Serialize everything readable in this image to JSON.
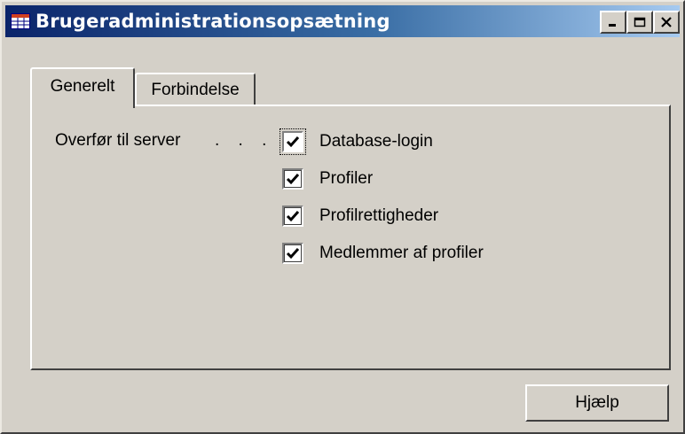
{
  "window": {
    "title": "Brugeradministrationsopsætning",
    "icon": "table-icon",
    "controls": {
      "minimize_icon": "minimize-icon",
      "maximize_icon": "maximize-icon",
      "close_icon": "close-icon"
    },
    "colors": {
      "titlebar_start": "#0a246a",
      "titlebar_end": "#a6caf0",
      "face": "#d4d0c8"
    }
  },
  "tabs": [
    {
      "label": "Generelt",
      "active": true
    },
    {
      "label": "Forbindelse",
      "active": false
    }
  ],
  "form": {
    "field_label": "Overfør til server",
    "leader_dots": ". . . .",
    "options": [
      {
        "label": "Database-login",
        "checked": true
      },
      {
        "label": "Profiler",
        "checked": true
      },
      {
        "label": "Profilrettigheder",
        "checked": true
      },
      {
        "label": "Medlemmer af profiler",
        "checked": true
      }
    ]
  },
  "buttons": {
    "help_label": "Hjælp"
  }
}
